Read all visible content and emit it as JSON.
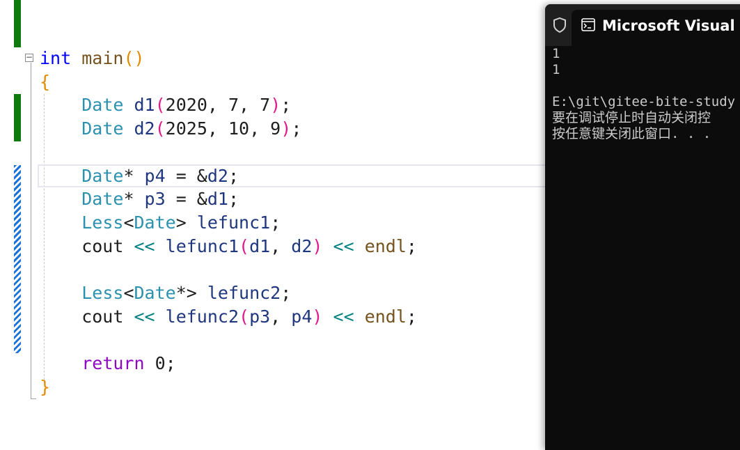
{
  "editor": {
    "fold_symbol": "−",
    "lines": [
      {
        "tokens": [
          {
            "t": "int",
            "c": "kw"
          },
          {
            "t": " "
          },
          {
            "t": "main",
            "c": "fn"
          },
          {
            "t": "()",
            "c": "brace"
          }
        ]
      },
      {
        "tokens": [
          {
            "t": "{",
            "c": "brace"
          }
        ]
      },
      {
        "tokens": [
          {
            "t": "    "
          },
          {
            "t": "Date",
            "c": "ty"
          },
          {
            "t": " "
          },
          {
            "t": "d1",
            "c": "var"
          },
          {
            "t": "(",
            "c": "paren"
          },
          {
            "t": "2020, 7, 7"
          },
          {
            "t": ")",
            "c": "paren"
          },
          {
            "t": ";"
          }
        ]
      },
      {
        "tokens": [
          {
            "t": "    "
          },
          {
            "t": "Date",
            "c": "ty"
          },
          {
            "t": " "
          },
          {
            "t": "d2",
            "c": "var"
          },
          {
            "t": "(",
            "c": "paren"
          },
          {
            "t": "2025, 10, 9"
          },
          {
            "t": ")",
            "c": "paren"
          },
          {
            "t": ";"
          }
        ]
      },
      {
        "tokens": []
      },
      {
        "tokens": [
          {
            "t": "    "
          },
          {
            "t": "Date",
            "c": "ty"
          },
          {
            "t": "* "
          },
          {
            "t": "p4",
            "c": "var"
          },
          {
            "t": " = &"
          },
          {
            "t": "d2",
            "c": "var"
          },
          {
            "t": ";"
          }
        ]
      },
      {
        "tokens": [
          {
            "t": "    "
          },
          {
            "t": "Date",
            "c": "ty"
          },
          {
            "t": "* "
          },
          {
            "t": "p3",
            "c": "var"
          },
          {
            "t": " = &"
          },
          {
            "t": "d1",
            "c": "var"
          },
          {
            "t": ";"
          }
        ]
      },
      {
        "tokens": [
          {
            "t": "    "
          },
          {
            "t": "Less",
            "c": "ty"
          },
          {
            "t": "<"
          },
          {
            "t": "Date",
            "c": "ty"
          },
          {
            "t": "> "
          },
          {
            "t": "lefunc1",
            "c": "var"
          },
          {
            "t": ";"
          }
        ]
      },
      {
        "tokens": [
          {
            "t": "    cout "
          },
          {
            "t": "<<",
            "c": "op"
          },
          {
            "t": " "
          },
          {
            "t": "lefunc1",
            "c": "var"
          },
          {
            "t": "(",
            "c": "paren"
          },
          {
            "t": "d1",
            "c": "var"
          },
          {
            "t": ", "
          },
          {
            "t": "d2",
            "c": "var"
          },
          {
            "t": ")",
            "c": "paren"
          },
          {
            "t": " "
          },
          {
            "t": "<<",
            "c": "op"
          },
          {
            "t": " "
          },
          {
            "t": "endl",
            "c": "fn"
          },
          {
            "t": ";"
          }
        ]
      },
      {
        "tokens": []
      },
      {
        "tokens": [
          {
            "t": "    "
          },
          {
            "t": "Less",
            "c": "ty"
          },
          {
            "t": "<"
          },
          {
            "t": "Date",
            "c": "ty"
          },
          {
            "t": "*> "
          },
          {
            "t": "lefunc2",
            "c": "var"
          },
          {
            "t": ";"
          }
        ]
      },
      {
        "tokens": [
          {
            "t": "    cout "
          },
          {
            "t": "<<",
            "c": "op"
          },
          {
            "t": " "
          },
          {
            "t": "lefunc2",
            "c": "var"
          },
          {
            "t": "(",
            "c": "paren"
          },
          {
            "t": "p3",
            "c": "var"
          },
          {
            "t": ", "
          },
          {
            "t": "p4",
            "c": "var"
          },
          {
            "t": ")",
            "c": "paren"
          },
          {
            "t": " "
          },
          {
            "t": "<<",
            "c": "op"
          },
          {
            "t": " "
          },
          {
            "t": "endl",
            "c": "fn"
          },
          {
            "t": ";"
          }
        ]
      },
      {
        "tokens": []
      },
      {
        "tokens": [
          {
            "t": "    "
          },
          {
            "t": "return",
            "c": "kw2"
          },
          {
            "t": " 0;"
          }
        ]
      },
      {
        "tokens": [
          {
            "t": "}",
            "c": "brace"
          }
        ]
      }
    ]
  },
  "console": {
    "tab_title": "Microsoft Visual Studio Debug Console",
    "tab_icons": [
      "shield-icon",
      "cmd-icon"
    ],
    "output_lines": [
      "1",
      "1",
      "",
      "E:\\git\\gitee-bite-study",
      "要在调试停止时自动关闭控",
      "按任意键关闭此窗口. . ."
    ]
  },
  "colors": {
    "keyword": "#0000ff",
    "return_keyword": "#8f08c4",
    "type": "#2b91af",
    "variable": "#1f377f",
    "function": "#74531f",
    "brace": "#e08a00",
    "paren": "#e01a8c",
    "operator": "#008080",
    "gutter_saved": "#0e7a0e",
    "gutter_unsaved": "#1a73d9",
    "console_bg": "#0c0c0c"
  }
}
